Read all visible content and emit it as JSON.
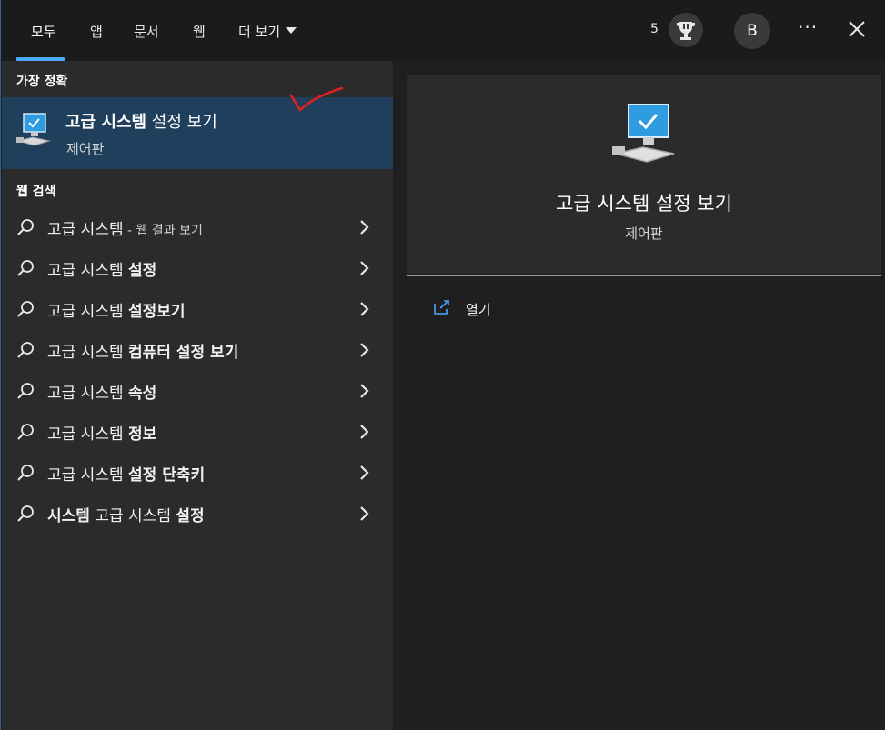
{
  "tabs": [
    {
      "label": "모두"
    },
    {
      "label": "앱"
    },
    {
      "label": "문서"
    },
    {
      "label": "웹"
    },
    {
      "label": "더 보기"
    }
  ],
  "header": {
    "points": "5",
    "avatar_initial": "B",
    "more_label": "···"
  },
  "best_match": {
    "section_label": "가장 정확",
    "title_bold": "고급 시스템",
    "title_rest": " 설정 보기",
    "subtitle": "제어판"
  },
  "web_search": {
    "section_label": "웹 검색",
    "results": [
      {
        "normal": "고급 시스템",
        "bold": "",
        "hint": " - 웹 결과 보기"
      },
      {
        "normal": "고급 시스템 ",
        "bold": "설정",
        "hint": ""
      },
      {
        "normal": "고급 시스템 ",
        "bold": "설정보기",
        "hint": ""
      },
      {
        "normal": "고급 시스템 ",
        "bold": "컴퓨터 설정 보기",
        "hint": ""
      },
      {
        "normal": "고급 시스템 ",
        "bold": "속성",
        "hint": ""
      },
      {
        "normal": "고급 시스템 ",
        "bold": "정보",
        "hint": ""
      },
      {
        "normal": "고급 시스템 ",
        "bold": "설정 단축키",
        "hint": ""
      }
    ],
    "last": {
      "bold1": "시스템",
      "normal": " 고급 시스템 ",
      "bold2": "설정"
    }
  },
  "preview": {
    "title": "고급 시스템 설정 보기",
    "subtitle": "제어판",
    "open_label": "열기"
  },
  "colors": {
    "accent": "#4da6ff",
    "selected_bg": "#1f3f5c",
    "annotation": "#e02020"
  }
}
